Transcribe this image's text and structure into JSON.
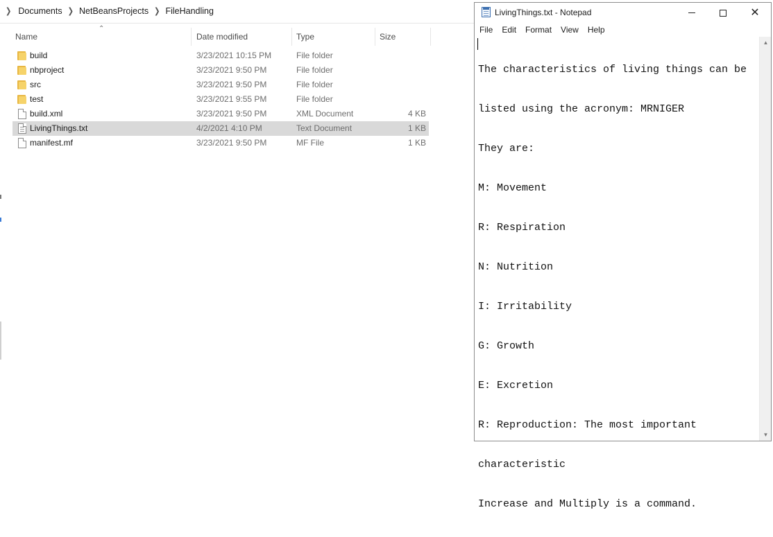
{
  "explorer": {
    "breadcrumb": [
      "Documents",
      "NetBeansProjects",
      "FileHandling"
    ],
    "columns": {
      "name": "Name",
      "date": "Date modified",
      "type": "Type",
      "size": "Size"
    },
    "files": [
      {
        "name": "build",
        "date": "3/23/2021 10:15 PM",
        "type": "File folder",
        "size": "",
        "icon": "folder-icon"
      },
      {
        "name": "nbproject",
        "date": "3/23/2021 9:50 PM",
        "type": "File folder",
        "size": "",
        "icon": "folder-icon"
      },
      {
        "name": "src",
        "date": "3/23/2021 9:50 PM",
        "type": "File folder",
        "size": "",
        "icon": "folder-icon"
      },
      {
        "name": "test",
        "date": "3/23/2021 9:55 PM",
        "type": "File folder",
        "size": "",
        "icon": "folder-icon"
      },
      {
        "name": "build.xml",
        "date": "3/23/2021 9:50 PM",
        "type": "XML Document",
        "size": "4 KB",
        "icon": "xml-file-icon"
      },
      {
        "name": "LivingThings.txt",
        "date": "4/2/2021 4:10 PM",
        "type": "Text Document",
        "size": "1 KB",
        "icon": "text-file-icon"
      },
      {
        "name": "manifest.mf",
        "date": "3/23/2021 9:50 PM",
        "type": "MF File",
        "size": "1 KB",
        "icon": "file-icon"
      }
    ],
    "selected_file": "LivingThings.txt"
  },
  "notepad": {
    "title": "LivingThings.txt - Notepad",
    "menu": [
      "File",
      "Edit",
      "Format",
      "View",
      "Help"
    ],
    "lines": [
      "The characteristics of living things can be",
      "listed using the acronym: MRNIGER",
      "They are:",
      "M: Movement",
      "R: Respiration",
      "N: Nutrition",
      "I: Irritability",
      "G: Growth",
      "E: Excretion",
      "R: Reproduction: The most important",
      "characteristic",
      "Increase and Multiply is a command."
    ]
  }
}
